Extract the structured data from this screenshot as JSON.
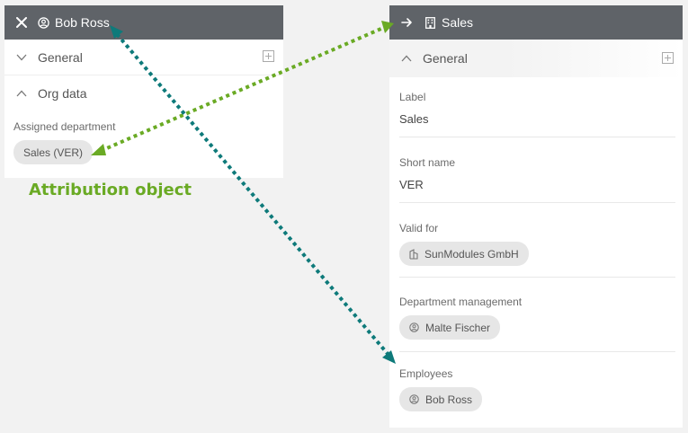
{
  "left_panel": {
    "title": "Bob Ross",
    "close_icon": "close-icon",
    "person_icon": "person-circle-icon",
    "sections": [
      {
        "label": "General",
        "state": "collapsed"
      },
      {
        "label": "Org data",
        "state": "expanded"
      }
    ],
    "assigned_department": {
      "label": "Assigned department",
      "value": "Sales (VER)"
    }
  },
  "annotation": {
    "text": "Attribution object",
    "color": "#6aaa24"
  },
  "right_panel": {
    "title": "Sales",
    "arrow_icon": "arrow-right-icon",
    "building_icon": "building-icon",
    "section": {
      "label": "General",
      "state": "expanded"
    },
    "fields": {
      "label": {
        "label": "Label",
        "value": "Sales"
      },
      "short_name": {
        "label": "Short name",
        "value": "VER"
      },
      "valid_for": {
        "label": "Valid for",
        "value": "SunModules GmbH"
      },
      "department_management": {
        "label": "Department management",
        "value": "Malte Fischer"
      },
      "employees": {
        "label": "Employees",
        "value": "Bob Ross"
      }
    }
  },
  "colors": {
    "header_bg": "#5f6368",
    "panel_bg": "#ffffff",
    "page_bg": "#f2f2f2",
    "chip_bg": "#e6e6e6",
    "green_arrow": "#6aaa24",
    "teal_arrow": "#0e7a7a"
  }
}
